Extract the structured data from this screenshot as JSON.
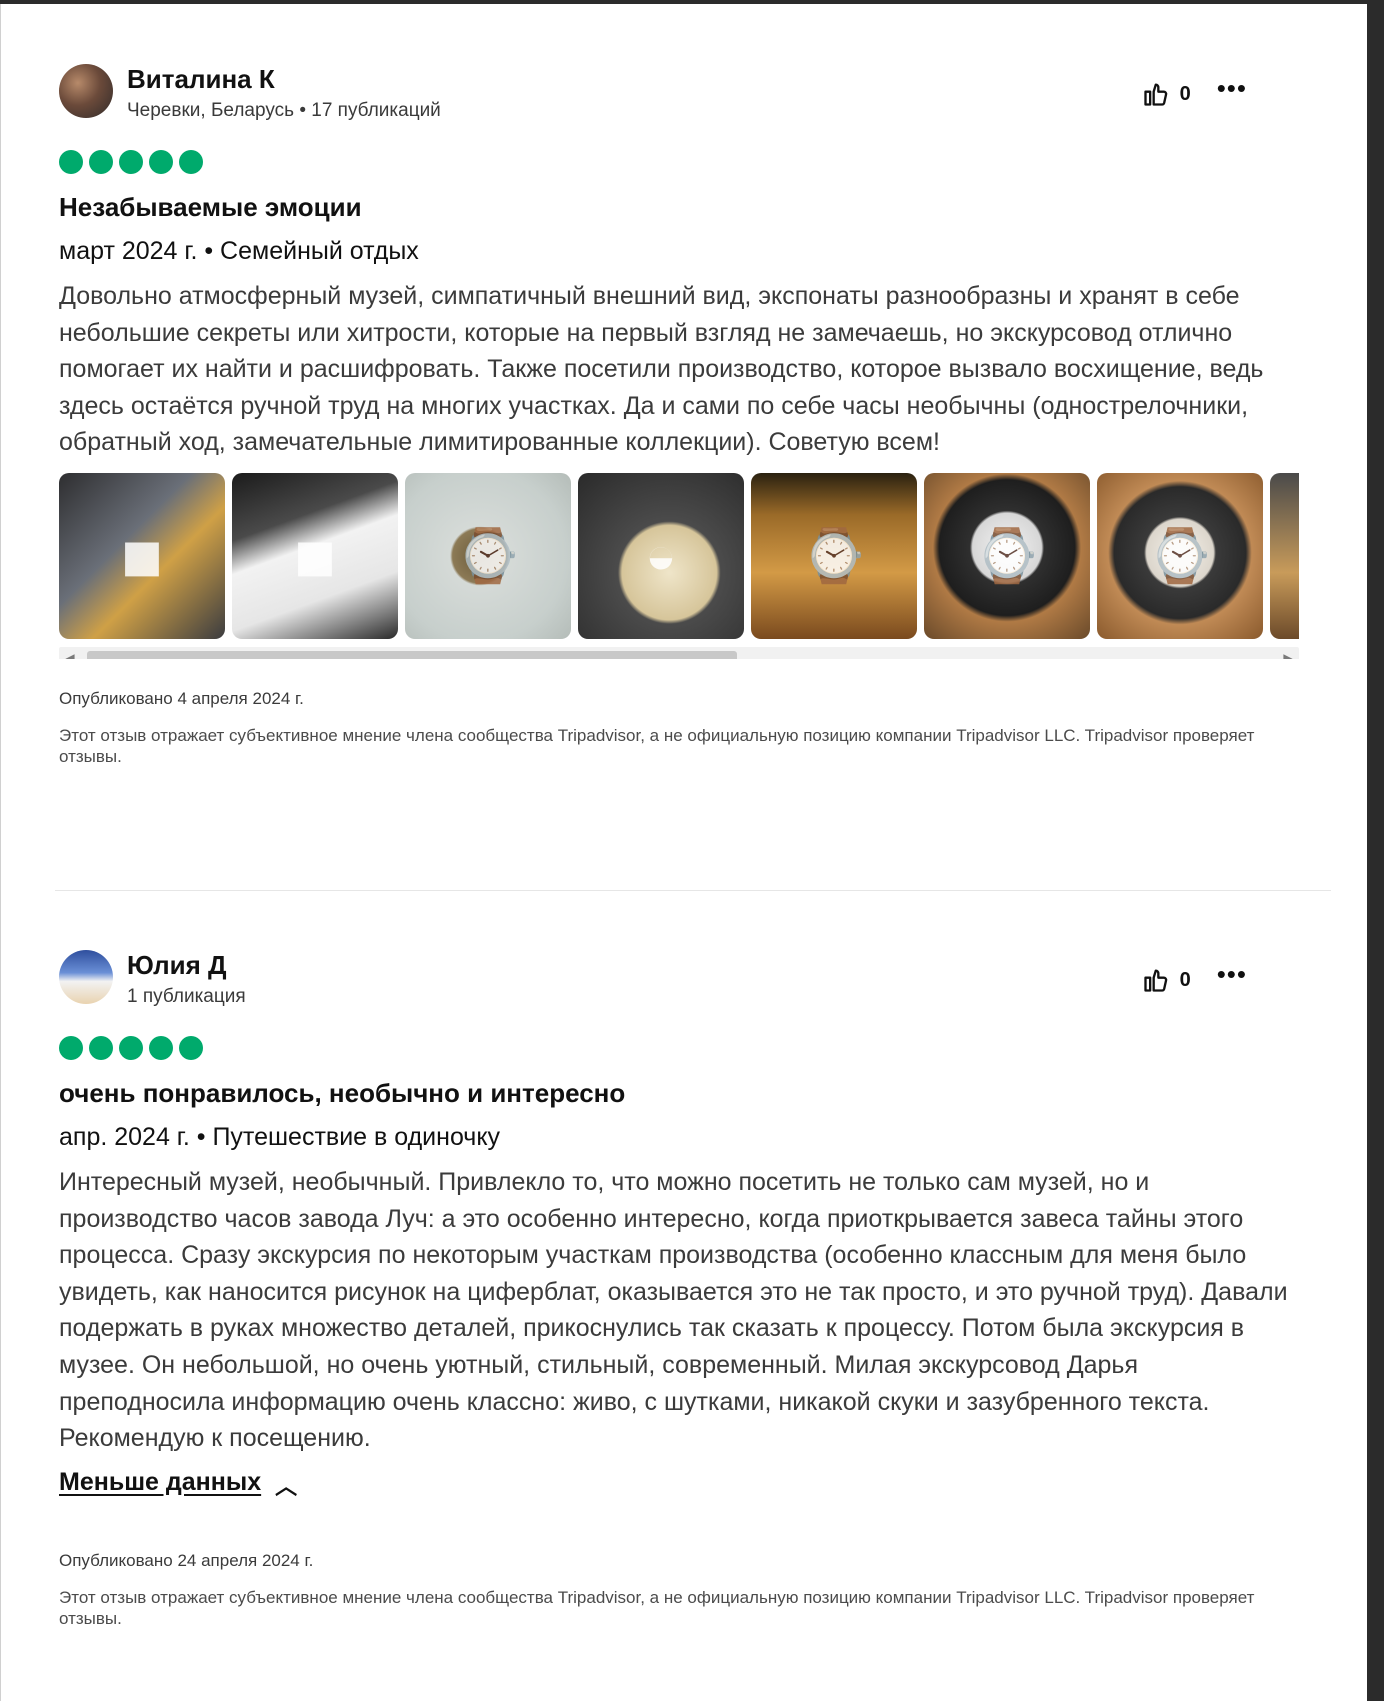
{
  "reviews": [
    {
      "user": {
        "name": "Виталина К",
        "meta": "Черевки, Беларусь • 17 публикаций"
      },
      "likes": "0",
      "more_icon": "ellipsis-icon",
      "rating": 5,
      "title": "Незабываемые эмоции",
      "trip": "март 2024 г. • Семейный отдых",
      "text": "Довольно атмосферный музей, симпатичный внешний вид, экспонаты разнообразны и хранят в себе небольшие секреты или хитрости, которые на первый взгляд не замечаешь, но экскурсовод отлично помогает их найти и расшифровать. Также посетили производство, которое вызвало восхищение, ведь здесь остаётся ручной труд на многих участках. Да и сами по себе часы необычны (однострелочники, обратный ход, замечательные лимитированные коллекции). Советую всем!",
      "photos_count": 8,
      "published": "Опубликовано 4 апреля 2024 г.",
      "disclaimer": "Этот отзыв отражает субъективное мнение члена сообщества Tripadvisor, а не официальную позицию компании Tripadvisor LLC. Tripadvisor проверяет отзывы."
    },
    {
      "user": {
        "name": "Юлия Д",
        "meta": "1 публикация"
      },
      "likes": "0",
      "more_icon": "ellipsis-icon",
      "rating": 5,
      "title": "очень понравилось, необычно и интересно",
      "trip": "апр. 2024 г. • Путешествие в одиночку",
      "text": "Интересный музей, необычный. Привлекло то, что можно посетить не только сам музей, но и производство часов завода Луч: а это особенно интересно, когда приоткрывается завеса тайны этого процесса. Сразу экскурсия по некоторым участкам производства (особенно классным для меня было увидеть, как наносится рисунок на циферблат, оказывается это не так просто, и это ручной труд). Давали подержать в руках множество деталей, прикоснулись так сказать к процессу. Потом была экскурсия в музее. Он небольшой, но очень уютный, стильный, современный. Милая экскурсовод Дарья преподносила информацию очень классно: живо, с шутками, никакой скуки и зазубренного текста. Рекомендую к посещению.",
      "less_label": "Меньше данных",
      "published": "Опубликовано 24 апреля 2024 г.",
      "disclaimer": "Этот отзыв отражает субъективное мнение члена сообщества Tripadvisor, а не официальную позицию компании Tripadvisor LLC. Tripadvisor проверяет отзывы."
    }
  ],
  "colors": {
    "rating_bubble": "#00aa6c",
    "text": "#3b3b3b"
  }
}
